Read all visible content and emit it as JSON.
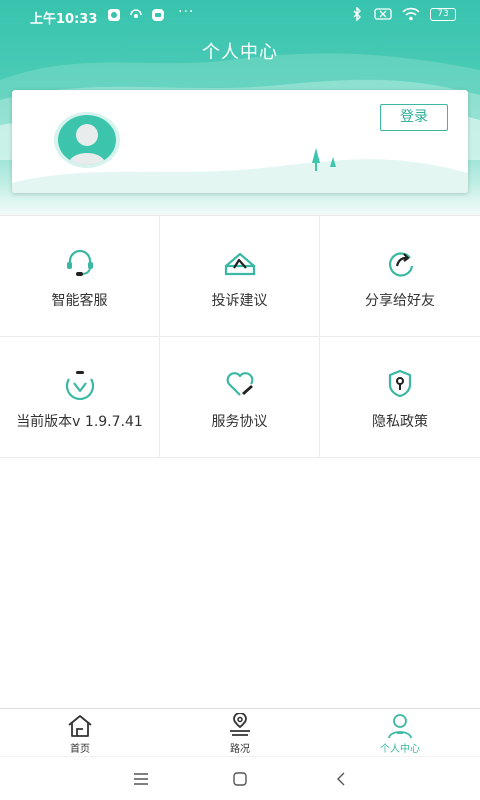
{
  "status_bar": {
    "time": "上午10:33",
    "dots": "···",
    "battery": "73"
  },
  "header": {
    "title": "个人中心"
  },
  "profile": {
    "login_label": "登录"
  },
  "grid": {
    "rows": [
      [
        {
          "label": "智能客服",
          "icon": "headset-icon"
        },
        {
          "label": "投诉建议",
          "icon": "envelope-icon"
        },
        {
          "label": "分享给好友",
          "icon": "share-icon"
        }
      ],
      [
        {
          "label": "当前版本v 1.9.7.41",
          "icon": "version-icon"
        },
        {
          "label": "服务协议",
          "icon": "heart-pen-icon"
        },
        {
          "label": "隐私政策",
          "icon": "shield-key-icon"
        }
      ]
    ]
  },
  "tab_bar": {
    "items": [
      {
        "label": "首页",
        "icon": "home-icon"
      },
      {
        "label": "路况",
        "icon": "road-location-icon"
      },
      {
        "label": "个人中心",
        "icon": "person-icon"
      }
    ]
  },
  "colors": {
    "accent": "#3bb8a3",
    "header_top": "#37c3ad"
  }
}
